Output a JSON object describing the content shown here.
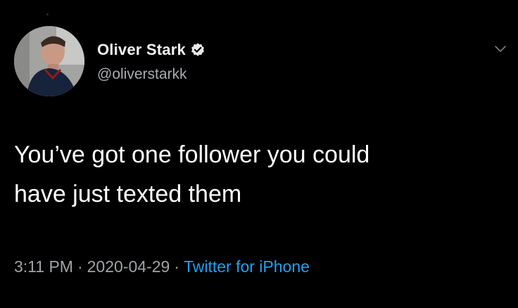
{
  "author": {
    "display_name": "Oliver Stark",
    "handle": "@oliverstarkk",
    "verified_icon": "verified-badge-icon",
    "avatar_icon": "profile-photo"
  },
  "tweet": {
    "text_line1": "You’ve got one follower you could",
    "text_line2": "have just texted them"
  },
  "meta": {
    "time": "3:11 PM",
    "separator": "·",
    "date": "2020-04-29",
    "source": "Twitter for iPhone"
  },
  "menu": {
    "icon": "chevron-down-icon"
  },
  "colors": {
    "background": "#000000",
    "text": "#ffffff",
    "secondary_text": "#a8acb0",
    "link": "#1da1f2"
  }
}
